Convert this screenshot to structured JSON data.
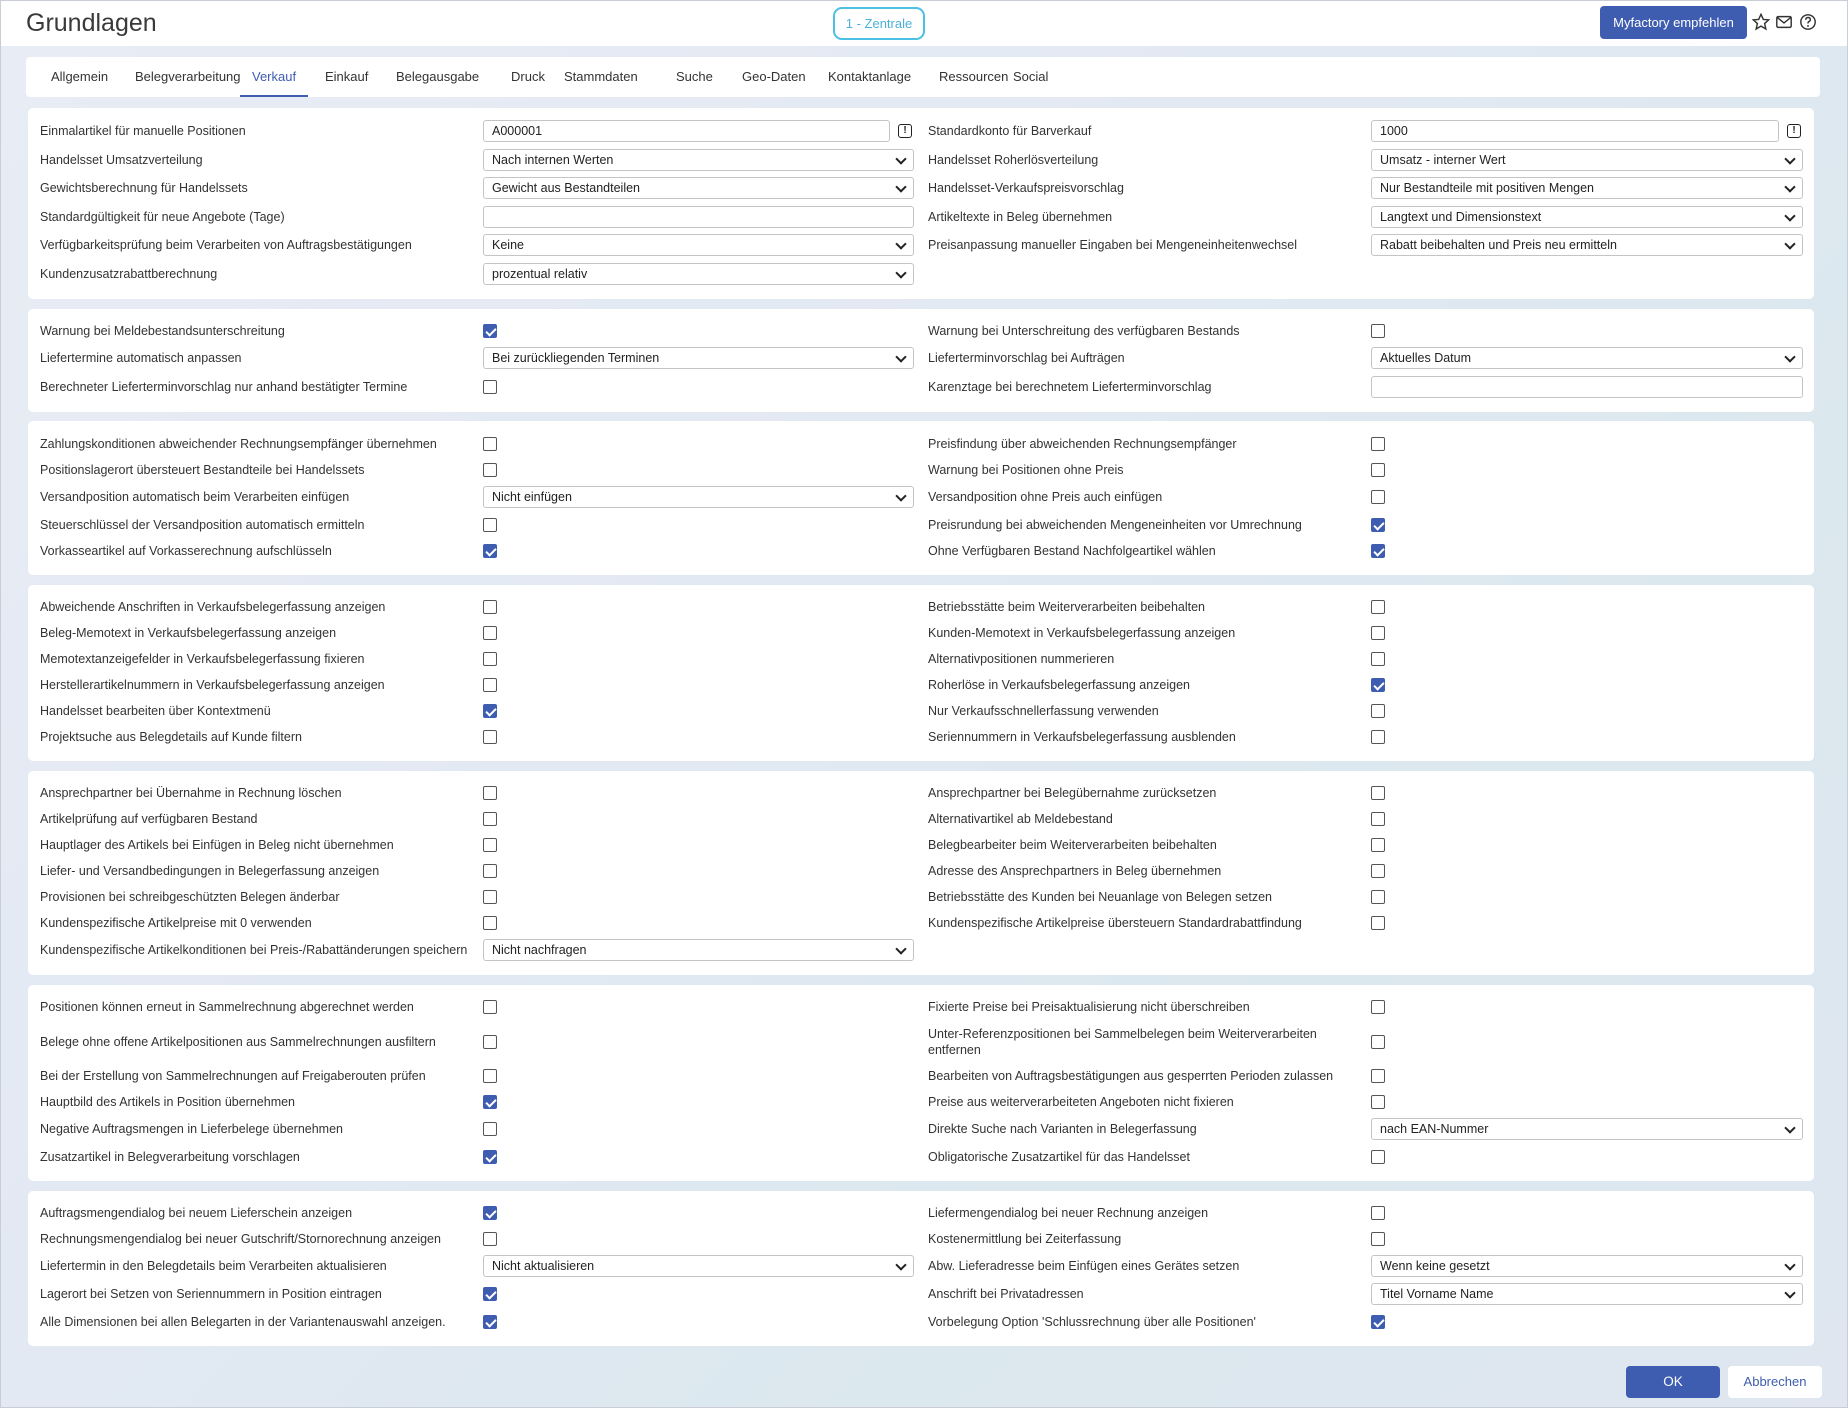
{
  "header": {
    "title": "Grundlagen",
    "company": "1 - Zentrale",
    "recommend_label": "Myfactory empfehlen",
    "icons": [
      "star-icon",
      "mail-icon",
      "help-icon"
    ]
  },
  "tabs": [
    {
      "label": "Allgemein",
      "active": false
    },
    {
      "label": "Belegverarbeitung",
      "active": false
    },
    {
      "label": "Verkauf",
      "active": true
    },
    {
      "label": "Einkauf",
      "active": false
    },
    {
      "label": "Belegausgabe",
      "active": false
    },
    {
      "label": "Druck",
      "active": false
    },
    {
      "label": "Stammdaten",
      "active": false
    },
    {
      "label": "Suche",
      "active": false
    },
    {
      "label": "Geo-Daten",
      "active": false
    },
    {
      "label": "Kontaktanlage",
      "active": false
    },
    {
      "label": "Ressourcen",
      "active": false
    },
    {
      "label": "Social",
      "active": false
    }
  ],
  "sections": [
    {
      "rows": [
        {
          "left": {
            "label": "Einmalartikel für manuelle Positionen",
            "type": "input",
            "value": "A000001",
            "info": true
          },
          "right": {
            "label": "Standardkonto für Barverkauf",
            "type": "input",
            "value": "1000",
            "info": true
          }
        },
        {
          "left": {
            "label": "Handelsset Umsatzverteilung",
            "type": "select",
            "value": "Nach internen Werten"
          },
          "right": {
            "label": "Handelsset Roherlösverteilung",
            "type": "select",
            "value": "Umsatz - interner Wert"
          }
        },
        {
          "left": {
            "label": "Gewichtsberechnung für Handelssets",
            "type": "select",
            "value": "Gewicht aus Bestandteilen"
          },
          "right": {
            "label": "Handelsset-Verkaufspreisvorschlag",
            "type": "select",
            "value": "Nur Bestandteile mit positiven Mengen"
          }
        },
        {
          "left": {
            "label": "Standardgültigkeit für neue Angebote (Tage)",
            "type": "input",
            "value": ""
          },
          "right": {
            "label": "Artikeltexte in Beleg übernehmen",
            "type": "select",
            "value": "Langtext und Dimensionstext"
          }
        },
        {
          "left": {
            "label": "Verfügbarkeitsprüfung beim Verarbeiten von Auftragsbestätigungen",
            "type": "select",
            "value": "Keine"
          },
          "right": {
            "label": "Preisanpassung manueller Eingaben bei Mengeneinheitenwechsel",
            "type": "select",
            "value": "Rabatt beibehalten und Preis neu ermitteln"
          }
        },
        {
          "left": {
            "label": "Kundenzusatzrabattberechnung",
            "type": "select",
            "value": "prozentual relativ"
          },
          "right": null
        }
      ]
    },
    {
      "rows": [
        {
          "left": {
            "label": "Warnung bei Meldebestandsunterschreitung",
            "type": "checkbox",
            "checked": true
          },
          "right": {
            "label": "Warnung bei Unterschreitung des verfügbaren Bestands",
            "type": "checkbox",
            "checked": false
          }
        },
        {
          "left": {
            "label": "Liefertermine automatisch anpassen",
            "type": "select",
            "value": "Bei zurückliegenden Terminen"
          },
          "right": {
            "label": "Lieferterminvorschlag bei Aufträgen",
            "type": "select",
            "value": "Aktuelles Datum"
          }
        },
        {
          "left": {
            "label": "Berechneter Lieferterminvorschlag nur anhand bestätigter Termine",
            "type": "checkbox",
            "checked": false
          },
          "right": {
            "label": "Karenztage bei berechnetem Lieferterminvorschlag",
            "type": "input",
            "value": ""
          }
        }
      ]
    },
    {
      "rows": [
        {
          "left": {
            "label": "Zahlungskonditionen abweichender Rechnungsempfänger übernehmen",
            "type": "checkbox",
            "checked": false
          },
          "right": {
            "label": "Preisfindung über abweichenden Rechnungsempfänger",
            "type": "checkbox",
            "checked": false
          }
        },
        {
          "left": {
            "label": "Positionslagerort übersteuert Bestandteile bei Handelssets",
            "type": "checkbox",
            "checked": false
          },
          "right": {
            "label": "Warnung bei Positionen ohne Preis",
            "type": "checkbox",
            "checked": false
          }
        },
        {
          "left": {
            "label": "Versandposition automatisch beim Verarbeiten einfügen",
            "type": "select",
            "value": "Nicht einfügen"
          },
          "right": {
            "label": "Versandposition ohne Preis auch einfügen",
            "type": "checkbox",
            "checked": false
          }
        },
        {
          "left": {
            "label": "Steuerschlüssel der Versandposition automatisch ermitteln",
            "type": "checkbox",
            "checked": false
          },
          "right": {
            "label": "Preisrundung bei abweichenden Mengeneinheiten vor Umrechnung",
            "type": "checkbox",
            "checked": true
          }
        },
        {
          "left": {
            "label": "Vorkasseartikel auf Vorkasserechnung aufschlüsseln",
            "type": "checkbox",
            "checked": true
          },
          "right": {
            "label": "Ohne Verfügbaren Bestand Nachfolgeartikel wählen",
            "type": "checkbox",
            "checked": true
          }
        }
      ]
    },
    {
      "rows": [
        {
          "left": {
            "label": "Abweichende Anschriften in Verkaufsbelegerfassung anzeigen",
            "type": "checkbox",
            "checked": false
          },
          "right": {
            "label": "Betriebsstätte beim Weiterverarbeiten beibehalten",
            "type": "checkbox",
            "checked": false
          }
        },
        {
          "left": {
            "label": "Beleg-Memotext in Verkaufsbelegerfassung anzeigen",
            "type": "checkbox",
            "checked": false
          },
          "right": {
            "label": "Kunden-Memotext in Verkaufsbelegerfassung anzeigen",
            "type": "checkbox",
            "checked": false
          }
        },
        {
          "left": {
            "label": "Memotextanzeigefelder in Verkaufsbelegerfassung fixieren",
            "type": "checkbox",
            "checked": false
          },
          "right": {
            "label": "Alternativpositionen nummerieren",
            "type": "checkbox",
            "checked": false
          }
        },
        {
          "left": {
            "label": "Herstellerartikelnummern in Verkaufsbelegerfassung anzeigen",
            "type": "checkbox",
            "checked": false
          },
          "right": {
            "label": "Roherlöse in Verkaufsbelegerfassung anzeigen",
            "type": "checkbox",
            "checked": true
          }
        },
        {
          "left": {
            "label": "Handelsset bearbeiten über Kontextmenü",
            "type": "checkbox",
            "checked": true
          },
          "right": {
            "label": "Nur Verkaufsschnellerfassung verwenden",
            "type": "checkbox",
            "checked": false
          }
        },
        {
          "left": {
            "label": "Projektsuche aus Belegdetails auf Kunde filtern",
            "type": "checkbox",
            "checked": false
          },
          "right": {
            "label": "Seriennummern in Verkaufsbelegerfassung ausblenden",
            "type": "checkbox",
            "checked": false
          }
        }
      ]
    },
    {
      "rows": [
        {
          "left": {
            "label": "Ansprechpartner bei Übernahme in Rechnung löschen",
            "type": "checkbox",
            "checked": false
          },
          "right": {
            "label": "Ansprechpartner bei Belegübernahme zurücksetzen",
            "type": "checkbox",
            "checked": false
          }
        },
        {
          "left": {
            "label": "Artikelprüfung auf verfügbaren Bestand",
            "type": "checkbox",
            "checked": false
          },
          "right": {
            "label": "Alternativartikel ab Meldebestand",
            "type": "checkbox",
            "checked": false
          }
        },
        {
          "left": {
            "label": "Hauptlager des Artikels bei Einfügen in Beleg nicht übernehmen",
            "type": "checkbox",
            "checked": false
          },
          "right": {
            "label": "Belegbearbeiter beim Weiterverarbeiten beibehalten",
            "type": "checkbox",
            "checked": false
          }
        },
        {
          "left": {
            "label": "Liefer- und Versandbedingungen in Belegerfassung anzeigen",
            "type": "checkbox",
            "checked": false
          },
          "right": {
            "label": "Adresse des Ansprechpartners in Beleg übernehmen",
            "type": "checkbox",
            "checked": false
          }
        },
        {
          "left": {
            "label": "Provisionen bei schreibgeschützten Belegen änderbar",
            "type": "checkbox",
            "checked": false
          },
          "right": {
            "label": "Betriebsstätte des Kunden bei Neuanlage von Belegen setzen",
            "type": "checkbox",
            "checked": false
          }
        },
        {
          "left": {
            "label": "Kundenspezifische Artikelpreise mit 0 verwenden",
            "type": "checkbox",
            "checked": false
          },
          "right": {
            "label": "Kundenspezifische Artikelpreise übersteuern Standardrabattfindung",
            "type": "checkbox",
            "checked": false
          }
        },
        {
          "left": {
            "label": "Kundenspezifische Artikelkonditionen bei Preis-/Rabattänderungen speichern",
            "type": "select",
            "value": "Nicht nachfragen"
          },
          "right": null
        }
      ]
    },
    {
      "rows": [
        {
          "left": {
            "label": "Positionen können erneut in Sammelrechnung abgerechnet werden",
            "type": "checkbox",
            "checked": false
          },
          "right": {
            "label": "Fixierte Preise bei Preisaktualisierung nicht überschreiben",
            "type": "checkbox",
            "checked": false
          }
        },
        {
          "left": {
            "label": "Belege ohne offene Artikelpositionen aus Sammelrechnungen ausfiltern",
            "type": "checkbox",
            "checked": false
          },
          "right": {
            "label": "Unter-Referenzpositionen bei Sammelbelegen beim Weiterverarbeiten entfernen",
            "type": "checkbox",
            "checked": false
          }
        },
        {
          "left": {
            "label": "Bei der Erstellung von Sammelrechnungen auf Freigaberouten prüfen",
            "type": "checkbox",
            "checked": false
          },
          "right": {
            "label": "Bearbeiten von Auftragsbestätigungen aus gesperrten Perioden zulassen",
            "type": "checkbox",
            "checked": false
          }
        },
        {
          "left": {
            "label": "Hauptbild des Artikels in Position übernehmen",
            "type": "checkbox",
            "checked": true
          },
          "right": {
            "label": "Preise aus weiterverarbeiteten Angeboten nicht fixieren",
            "type": "checkbox",
            "checked": false
          }
        },
        {
          "left": {
            "label": "Negative Auftragsmengen in Lieferbelege übernehmen",
            "type": "checkbox",
            "checked": false
          },
          "right": {
            "label": "Direkte Suche nach Varianten in Belegerfassung",
            "type": "select",
            "value": "nach EAN-Nummer"
          }
        },
        {
          "left": {
            "label": "Zusatzartikel in Belegverarbeitung vorschlagen",
            "type": "checkbox",
            "checked": true
          },
          "right": {
            "label": "Obligatorische Zusatzartikel für das Handelsset",
            "type": "checkbox",
            "checked": false
          }
        }
      ]
    },
    {
      "rows": [
        {
          "left": {
            "label": "Auftragsmengendialog bei neuem Lieferschein anzeigen",
            "type": "checkbox",
            "checked": true
          },
          "right": {
            "label": "Liefermengendialog bei neuer Rechnung anzeigen",
            "type": "checkbox",
            "checked": false
          }
        },
        {
          "left": {
            "label": "Rechnungsmengendialog bei neuer Gutschrift/Stornorechnung anzeigen",
            "type": "checkbox",
            "checked": false
          },
          "right": {
            "label": "Kostenermittlung bei Zeiterfassung",
            "type": "checkbox",
            "checked": false
          }
        },
        {
          "left": {
            "label": "Liefertermin in den Belegdetails beim Verarbeiten aktualisieren",
            "type": "select",
            "value": "Nicht aktualisieren"
          },
          "right": {
            "label": "Abw. Lieferadresse beim Einfügen eines Gerätes setzen",
            "type": "select",
            "value": "Wenn keine gesetzt"
          }
        },
        {
          "left": {
            "label": "Lagerort bei Setzen von Seriennummern in Position eintragen",
            "type": "checkbox",
            "checked": true
          },
          "right": {
            "label": "Anschrift bei Privatadressen",
            "type": "select",
            "value": "Titel Vorname Name"
          }
        },
        {
          "left": {
            "label": "Alle Dimensionen bei allen Belegarten in der Variantenauswahl anzeigen.",
            "type": "checkbox",
            "checked": true
          },
          "right": {
            "label": "Vorbelegung Option 'Schlussrechnung über alle Positionen'",
            "type": "checkbox",
            "checked": true
          }
        }
      ]
    }
  ],
  "footer": {
    "ok_label": "OK",
    "cancel_label": "Abbrechen"
  }
}
